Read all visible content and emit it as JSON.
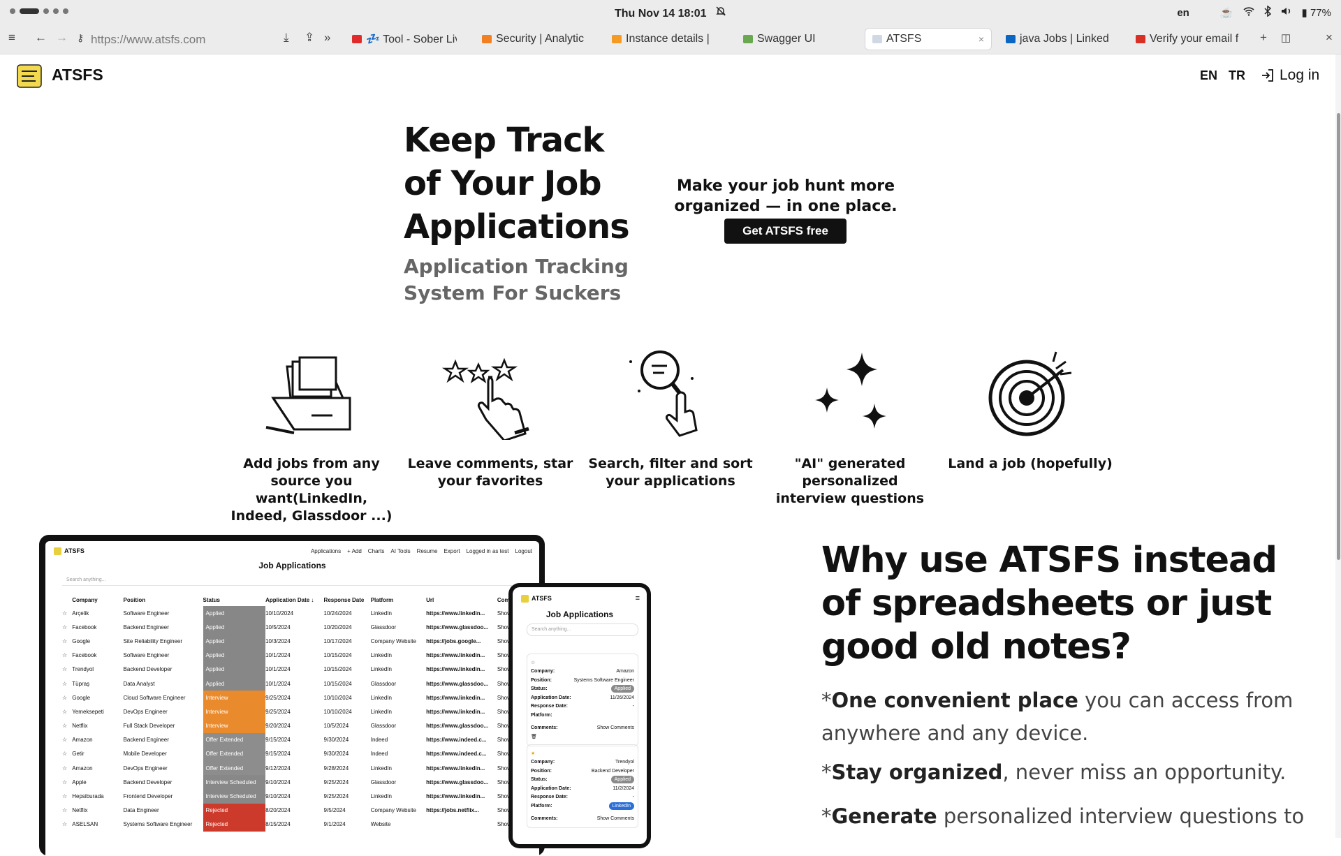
{
  "os": {
    "clock": "Thu Nov 14  18:01",
    "keyboard_lang": "en",
    "battery": "77%"
  },
  "browser": {
    "address": "https://www.atsfs.com",
    "tabs": [
      {
        "label": "💤 Tool - Sober Liv",
        "fav": "#e02b2b",
        "active": false
      },
      {
        "label": "Security | Analytic",
        "fav": "#f38020",
        "active": false
      },
      {
        "label": "Instance details |",
        "fav": "#f59a23",
        "active": false
      },
      {
        "label": "Swagger UI",
        "fav": "#6aa84f",
        "active": false
      },
      {
        "label": "ATSFS",
        "fav": "#cfd8e3",
        "active": true
      },
      {
        "label": "java Jobs | Linked",
        "fav": "#0a66c2",
        "active": false
      },
      {
        "label": "Verify your email f",
        "fav": "#d93025",
        "active": false
      }
    ]
  },
  "site": {
    "name": "ATSFS",
    "lang_en": "EN",
    "lang_tr": "TR",
    "login": "Log in"
  },
  "hero": {
    "title": "Keep Track of Your Job Applications",
    "subtitle": "Application Tracking System For Suckers",
    "tagline": "Make your job hunt more organized — in one place.",
    "cta": "Get ATSFS free"
  },
  "features": [
    {
      "icon": "file-drawer-icon",
      "label": "Add jobs from any source you want(LinkedIn, Indeed, Glassdoor ...)"
    },
    {
      "icon": "star-tap-icon",
      "label": "Leave comments, star your favorites"
    },
    {
      "icon": "magnifier-icon",
      "label": "Search, filter and sort your applications"
    },
    {
      "icon": "sparkles-icon",
      "label": "\"AI\" generated personalized interview questions"
    },
    {
      "icon": "target-icon",
      "label": "Land a job (hopefully)"
    }
  ],
  "laptop": {
    "brand": "ATSFS",
    "nav": [
      "Applications",
      "+ Add",
      "Charts",
      "AI Tools",
      "Resume",
      "Export",
      "Logged in as test",
      "Logout"
    ],
    "title": "Job Applications",
    "search_placeholder": "Search anything...",
    "columns": [
      "",
      "Company",
      "Position",
      "Status",
      "Application Date ↓",
      "Response Date",
      "Platform",
      "Url",
      "Comments"
    ],
    "rows": [
      {
        "company": "Arçelik",
        "position": "Software Engineer",
        "status": "Applied",
        "kind": "applied",
        "app_date": "10/10/2024",
        "resp_date": "10/24/2024",
        "platform": "LinkedIn",
        "url": "https://www.linkedin...",
        "comments": "Show"
      },
      {
        "company": "Facebook",
        "position": "Backend Engineer",
        "status": "Applied",
        "kind": "applied",
        "app_date": "10/5/2024",
        "resp_date": "10/20/2024",
        "platform": "Glassdoor",
        "url": "https://www.glassdoo...",
        "comments": "Show"
      },
      {
        "company": "Google",
        "position": "Site Reliability Engineer",
        "status": "Applied",
        "kind": "applied",
        "app_date": "10/3/2024",
        "resp_date": "10/17/2024",
        "platform": "Company Website",
        "url": "https://jobs.google...",
        "comments": "Show"
      },
      {
        "company": "Facebook",
        "position": "Software Engineer",
        "status": "Applied",
        "kind": "applied",
        "app_date": "10/1/2024",
        "resp_date": "10/15/2024",
        "platform": "LinkedIn",
        "url": "https://www.linkedin...",
        "comments": "Show"
      },
      {
        "company": "Trendyol",
        "position": "Backend Developer",
        "status": "Applied",
        "kind": "applied",
        "app_date": "10/1/2024",
        "resp_date": "10/15/2024",
        "platform": "LinkedIn",
        "url": "https://www.linkedin...",
        "comments": "Show"
      },
      {
        "company": "Tüpraş",
        "position": "Data Analyst",
        "status": "Applied",
        "kind": "applied",
        "app_date": "10/1/2024",
        "resp_date": "10/15/2024",
        "platform": "Glassdoor",
        "url": "https://www.glassdoo...",
        "comments": "Show"
      },
      {
        "company": "Google",
        "position": "Cloud Software Engineer",
        "status": "Interview",
        "kind": "interview",
        "app_date": "9/25/2024",
        "resp_date": "10/10/2024",
        "platform": "LinkedIn",
        "url": "https://www.linkedin...",
        "comments": "Show"
      },
      {
        "company": "Yemeksepeti",
        "position": "DevOps Engineer",
        "status": "Interview",
        "kind": "interview",
        "app_date": "9/25/2024",
        "resp_date": "10/10/2024",
        "platform": "LinkedIn",
        "url": "https://www.linkedin...",
        "comments": "Show"
      },
      {
        "company": "Netflix",
        "position": "Full Stack Developer",
        "status": "Interview",
        "kind": "interview",
        "app_date": "9/20/2024",
        "resp_date": "10/5/2024",
        "platform": "Glassdoor",
        "url": "https://www.glassdoo...",
        "comments": "Show"
      },
      {
        "company": "Amazon",
        "position": "Backend Engineer",
        "status": "Offer Extended",
        "kind": "offer",
        "app_date": "9/15/2024",
        "resp_date": "9/30/2024",
        "platform": "Indeed",
        "url": "https://www.indeed.c...",
        "comments": "Show"
      },
      {
        "company": "Getir",
        "position": "Mobile Developer",
        "status": "Offer Extended",
        "kind": "offer",
        "app_date": "9/15/2024",
        "resp_date": "9/30/2024",
        "platform": "Indeed",
        "url": "https://www.indeed.c...",
        "comments": "Show"
      },
      {
        "company": "Amazon",
        "position": "DevOps Engineer",
        "status": "Offer Extended",
        "kind": "offer",
        "app_date": "9/12/2024",
        "resp_date": "9/28/2024",
        "platform": "LinkedIn",
        "url": "https://www.linkedin...",
        "comments": "Show"
      },
      {
        "company": "Apple",
        "position": "Backend Developer",
        "status": "Interview Scheduled",
        "kind": "sched",
        "app_date": "9/10/2024",
        "resp_date": "9/25/2024",
        "platform": "Glassdoor",
        "url": "https://www.glassdoo...",
        "comments": "Show"
      },
      {
        "company": "Hepsiburada",
        "position": "Frontend Developer",
        "status": "Interview Scheduled",
        "kind": "sched",
        "app_date": "9/10/2024",
        "resp_date": "9/25/2024",
        "platform": "LinkedIn",
        "url": "https://www.linkedin...",
        "comments": "Show"
      },
      {
        "company": "Netflix",
        "position": "Data Engineer",
        "status": "Rejected",
        "kind": "rejected",
        "app_date": "8/20/2024",
        "resp_date": "9/5/2024",
        "platform": "Company Website",
        "url": "https://jobs.netflix...",
        "comments": "Show"
      },
      {
        "company": "ASELSAN",
        "position": "Systems Software Engineer",
        "status": "Rejected",
        "kind": "rejected",
        "app_date": "8/15/2024",
        "resp_date": "9/1/2024",
        "platform": "Website",
        "url": "",
        "comments": "Show"
      }
    ]
  },
  "phone": {
    "brand": "ATSFS",
    "title": "Job Applications",
    "search_placeholder": "Search anything...",
    "field_labels": {
      "company": "Company:",
      "position": "Position:",
      "status": "Status:",
      "app_date": "Application Date:",
      "resp_date": "Response Date:",
      "platform": "Platform:",
      "comments": "Comments:",
      "show_comments": "Show Comments"
    },
    "cards": [
      {
        "company": "Amazon",
        "position": "Systems Software Engineer",
        "status": "Applied",
        "app_date": "11/26/2024",
        "resp_date": "-",
        "platform": "",
        "starred": false
      },
      {
        "company": "Trendyol",
        "position": "Backend Developer",
        "status": "Applied",
        "app_date": "11/2/2024",
        "resp_date": "-",
        "platform": "LinkedIn",
        "starred": true
      }
    ]
  },
  "why": {
    "title": "Why use ATSFS instead of spreadsheets or just good old notes?",
    "points": [
      {
        "bold": "One convenient place",
        "rest": " you can access from anywhere and any device."
      },
      {
        "bold": "Stay organized",
        "rest": ", never miss an opportunity."
      },
      {
        "bold": "Generate",
        "rest": " personalized interview questions to"
      }
    ]
  }
}
